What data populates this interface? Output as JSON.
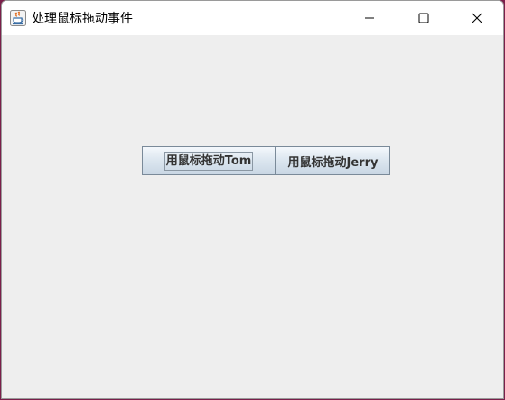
{
  "window": {
    "title": "处理鼠标拖动事件",
    "icon": "java-cup-icon"
  },
  "titlebar_controls": {
    "minimize_icon": "minimize-icon",
    "maximize_icon": "maximize-icon",
    "close_icon": "close-icon"
  },
  "buttons": {
    "tom_label": "用鼠标拖动Tom",
    "jerry_label": "用鼠标拖动Jerry"
  },
  "colors": {
    "content_background": "#eeeeee",
    "titlebar_background": "#ffffff",
    "button_border": "#7a8a99"
  }
}
